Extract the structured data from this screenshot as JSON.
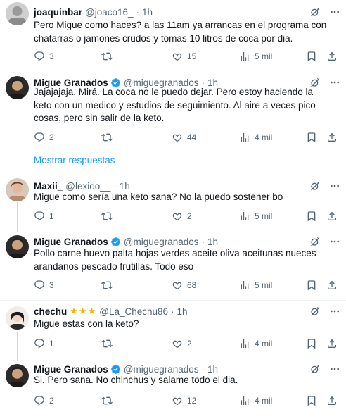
{
  "tweets": [
    {
      "name": "joaquinbar",
      "handle": "@joaco16_",
      "time": "1h",
      "text": "Pero Migue como haces? a las 11am ya arrancas en el programa con chatarras o jamones crudos y tomas 10 litros de coca por dia.",
      "replies": "3",
      "retweets": "",
      "likes": "15",
      "views": "5 mil"
    },
    {
      "name": "Migue Granados",
      "handle": "@miguegranados",
      "time": "1h",
      "text": "Jajajajaja. Mirá. La coca no le puedo dejar. Pero estoy haciendo la keto con un medico y estudios de seguimiento. Al aire a veces pico cosas, pero sin salir de la keto.",
      "replies": "2",
      "retweets": "",
      "likes": "44",
      "views": "4 mil"
    },
    {
      "name": "Maxii_",
      "handle": "@lexioo__",
      "time": "1h",
      "text": "Migue como sería una keto sana? No la puedo sostener bo",
      "replies": "1",
      "retweets": "",
      "likes": "2",
      "views": "5 mil"
    },
    {
      "name": "Migue Granados",
      "handle": "@miguegranados",
      "time": "1h",
      "text": "Pollo carne huevo palta hojas verdes aceite oliva aceitunas nueces arandanos pescado frutillas. Todo eso",
      "replies": "3",
      "retweets": "",
      "likes": "68",
      "views": "5 mil"
    },
    {
      "name": "chechu",
      "stars": "★★★",
      "handle": "@La_Chechu86",
      "time": "1h",
      "text": "Migue estas con la keto?",
      "replies": "1",
      "retweets": "",
      "likes": "2",
      "views": "4 mil"
    },
    {
      "name": "Migue Granados",
      "handle": "@miguegranados",
      "time": "1h",
      "text": "Si. Pero sana. No chinchus y salame todo el dia.",
      "replies": "2",
      "retweets": "",
      "likes": "12",
      "views": "4 mil"
    }
  ],
  "show_replies_label": "Mostrar respuestas",
  "dot": "·",
  "colors": {
    "link": "#1d9bf0",
    "muted": "#536471",
    "verified": "#1d9bf0",
    "stars": "#f4b400"
  },
  "icons": {
    "reply": "reply-icon",
    "retweet": "retweet-icon",
    "like": "like-icon",
    "views": "views-icon",
    "bookmark": "bookmark-icon",
    "share": "share-icon",
    "grok": "grok-icon",
    "more": "more-icon",
    "verified": "verified-badge-icon"
  }
}
